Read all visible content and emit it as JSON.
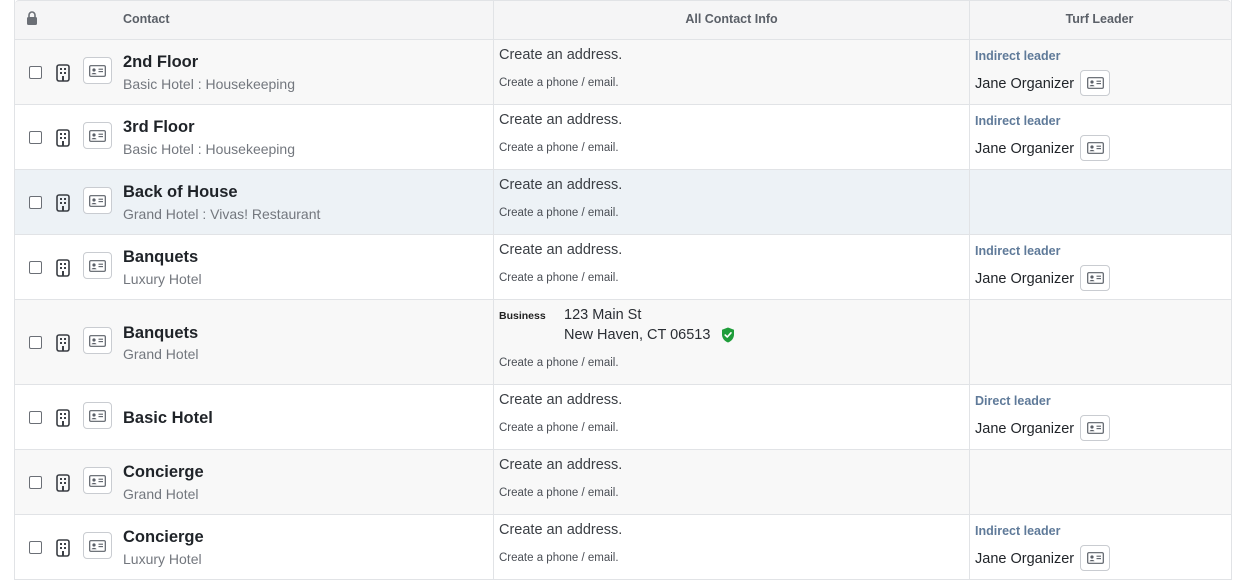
{
  "header": {
    "contact": "Contact",
    "all_contact_info": "All Contact Info",
    "turf_leader": "Turf Leader",
    "lock_icon": "lock-icon"
  },
  "icons": {
    "row_type": "building-icon",
    "contact_card": "contact-card-icon",
    "verified": "verified-shield-icon"
  },
  "colors": {
    "role_text": "#5f7a99",
    "verified": "#1f9d3a",
    "highlight_row": "#edf2f6"
  },
  "rows": [
    {
      "name": "2nd Floor",
      "sub": "Basic Hotel : Housekeeping",
      "address": "Create an address.",
      "phone": "Create a phone / email.",
      "role": "Indirect leader",
      "leader": "Jane Organizer"
    },
    {
      "name": "3rd Floor",
      "sub": "Basic Hotel : Housekeeping",
      "address": "Create an address.",
      "phone": "Create a phone / email.",
      "role": "Indirect leader",
      "leader": "Jane Organizer"
    },
    {
      "name": "Back of House",
      "sub": "Grand Hotel : Vivas! Restaurant",
      "address": "Create an address.",
      "phone": "Create a phone / email.",
      "role": "",
      "leader": ""
    },
    {
      "name": "Banquets",
      "sub": "Luxury Hotel",
      "address": "Create an address.",
      "phone": "Create a phone / email.",
      "role": "Indirect leader",
      "leader": "Jane Organizer"
    },
    {
      "name": "Banquets",
      "sub": "Grand Hotel",
      "address_label": "Business",
      "address_line1": "123 Main St",
      "address_line2": "New Haven, CT 06513",
      "phone": "Create a phone / email.",
      "role": "",
      "leader": ""
    },
    {
      "name": "Basic Hotel",
      "sub": "",
      "address": "Create an address.",
      "phone": "Create a phone / email.",
      "role": "Direct leader",
      "leader": "Jane Organizer"
    },
    {
      "name": "Concierge",
      "sub": "Grand Hotel",
      "address": "Create an address.",
      "phone": "Create a phone / email.",
      "role": "",
      "leader": ""
    },
    {
      "name": "Concierge",
      "sub": "Luxury Hotel",
      "address": "Create an address.",
      "phone": "Create a phone / email.",
      "role": "Indirect leader",
      "leader": "Jane Organizer"
    }
  ]
}
